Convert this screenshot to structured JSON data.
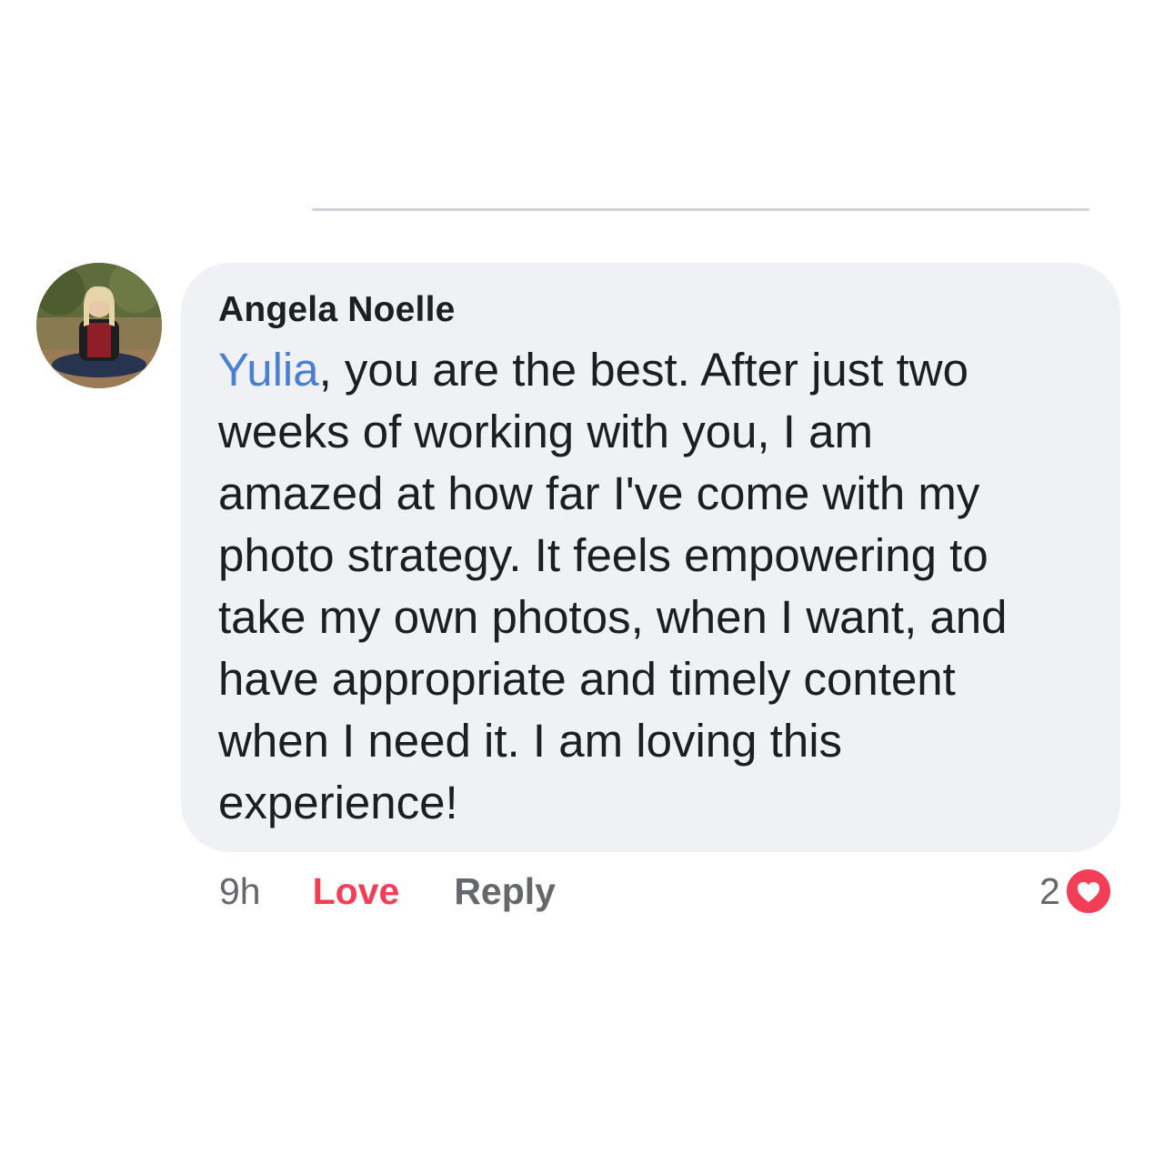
{
  "comment": {
    "author": "Angela Noelle",
    "mention": "Yulia",
    "text_lines": [
      ", you are the best.  After just two",
      "weeks of working with you, I am",
      "amazed at how far I've come with my",
      "photo strategy.  It feels empowering to",
      "take my own photos, when I want, and",
      "have appropriate and timely content",
      "when I need it.  I am loving this",
      "experience!"
    ],
    "timestamp": "9h",
    "love_label": "Love",
    "reply_label": "Reply",
    "reaction_count": "2",
    "reaction_icon": "heart-icon"
  },
  "colors": {
    "bubble_bg": "#f0f1f4",
    "mention": "#4a7fd4",
    "love": "#f33e58",
    "meta": "#65676b"
  }
}
